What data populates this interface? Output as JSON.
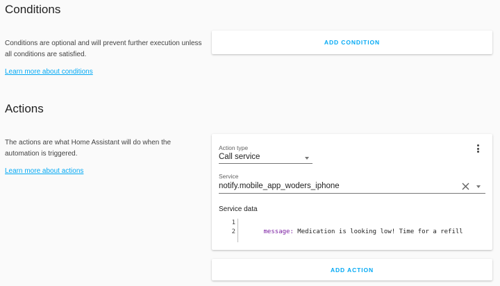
{
  "conditions": {
    "title": "Conditions",
    "description": "Conditions are optional and will prevent further execution unless all conditions are satisfied.",
    "learn_more": "Learn more about conditions",
    "add_button": "ADD CONDITION"
  },
  "actions": {
    "title": "Actions",
    "description": "The actions are what Home Assistant will do when the automation is triggered.",
    "learn_more": "Learn more about actions",
    "action_type_label": "Action type",
    "action_type_value": "Call service",
    "service_label": "Service",
    "service_value": "notify.mobile_app_woders_iphone",
    "service_data_label": "Service data",
    "code_lines": [
      {
        "number": "1",
        "key": "message:",
        "value": " Medication is looking low! Time for a refill"
      },
      {
        "number": "2",
        "key": "",
        "value": ""
      }
    ],
    "add_button": "ADD ACTION"
  },
  "colors": {
    "accent": "#03a9f4",
    "background": "#fafafa",
    "card": "#ffffff"
  },
  "icons": {
    "menu": "more-vert-icon",
    "clear": "close-icon",
    "dropdown": "arrow-drop-down-icon"
  }
}
